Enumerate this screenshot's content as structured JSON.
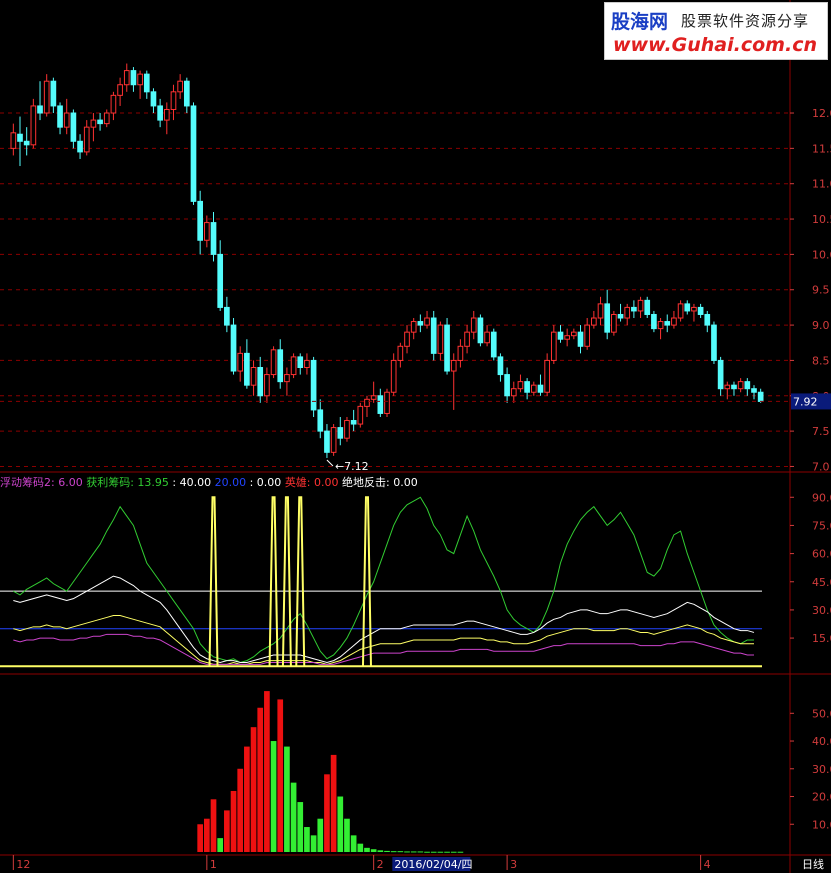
{
  "logo": {
    "brand": "股海网",
    "slogan": "股票软件资源分享",
    "url": "www.Guhai.com.cn"
  },
  "colors": {
    "up": "#ff3232",
    "down": "#54fcfc",
    "grid": "#8b0000",
    "axis": "#d23c3c",
    "green": "#32cd32",
    "white": "#ffffff",
    "yellow": "#ffff66",
    "magenta": "#cc44cc",
    "blue": "#2244ff"
  },
  "price_panel": {
    "y_ticks": [
      "12.0",
      "11.5",
      "11.0",
      "10.5",
      "10.0",
      "9.5",
      "9.0",
      "8.5",
      "8.0",
      "7.5",
      "7.0"
    ],
    "y_values": [
      12.0,
      11.5,
      11.0,
      10.5,
      10.0,
      9.5,
      9.0,
      8.5,
      8.0,
      7.5,
      7.0
    ],
    "current_price": "7.92",
    "low_marker": "7.12"
  },
  "indicator_panel": {
    "legend": [
      {
        "label": "浮动筹码2: ",
        "value": "6.00",
        "color": "#cc44cc"
      },
      {
        "label": "获利筹码: ",
        "value": "13.95",
        "color": "#32cd32"
      },
      {
        "label": " : ",
        "value": "40.00",
        "color": "#ffffff"
      },
      {
        "label": "20.00",
        "value": "",
        "color": "#2244ff"
      },
      {
        "label": " : ",
        "value": "0.00",
        "color": "#ffffff"
      },
      {
        "label": "英雄: ",
        "value": "0.00",
        "color": "#ff3232"
      },
      {
        "label": "绝地反击: ",
        "value": "0.00",
        "color": "#ffffff"
      }
    ],
    "y_ticks": [
      "90.0",
      "75.0",
      "60.0",
      "45.0",
      "30.0",
      "15.0"
    ],
    "y_values": [
      90,
      75,
      60,
      45,
      30,
      15
    ],
    "reference_lines": [
      40,
      20,
      0
    ]
  },
  "histogram_panel": {
    "y_ticks": [
      "50.0",
      "40.0",
      "30.0",
      "20.0",
      "10.0"
    ],
    "y_values": [
      50,
      40,
      30,
      20,
      10
    ]
  },
  "time_axis": {
    "labels": [
      {
        "text": "12",
        "index": 0
      },
      {
        "text": "1",
        "index": 29
      },
      {
        "text": "2",
        "index": 54
      },
      {
        "text": "3",
        "index": 74
      },
      {
        "text": "4",
        "index": 103
      }
    ],
    "cursor_date": "2016/02/04/四",
    "cursor_index": 58,
    "period": "日线"
  },
  "chart_data": {
    "type": "candlestick",
    "ohlc": [
      [
        11.5,
        11.85,
        11.4,
        11.72
      ],
      [
        11.7,
        11.95,
        11.25,
        11.6
      ],
      [
        11.6,
        11.8,
        11.4,
        11.55
      ],
      [
        11.55,
        12.2,
        11.5,
        12.1
      ],
      [
        12.1,
        12.45,
        11.9,
        12.0
      ],
      [
        12.0,
        12.55,
        11.95,
        12.45
      ],
      [
        12.45,
        12.5,
        12.0,
        12.1
      ],
      [
        12.1,
        12.15,
        11.7,
        11.8
      ],
      [
        11.8,
        12.2,
        11.7,
        12.0
      ],
      [
        12.0,
        12.05,
        11.5,
        11.6
      ],
      [
        11.6,
        11.7,
        11.35,
        11.45
      ],
      [
        11.45,
        11.9,
        11.4,
        11.8
      ],
      [
        11.8,
        12.0,
        11.6,
        11.9
      ],
      [
        11.9,
        12.0,
        11.75,
        11.85
      ],
      [
        11.85,
        12.05,
        11.8,
        12.0
      ],
      [
        12.0,
        12.3,
        11.9,
        12.25
      ],
      [
        12.25,
        12.5,
        12.1,
        12.4
      ],
      [
        12.4,
        12.7,
        12.3,
        12.6
      ],
      [
        12.6,
        12.65,
        12.3,
        12.4
      ],
      [
        12.4,
        12.6,
        12.2,
        12.55
      ],
      [
        12.55,
        12.6,
        12.2,
        12.3
      ],
      [
        12.3,
        12.35,
        12.0,
        12.1
      ],
      [
        12.1,
        12.2,
        11.8,
        11.9
      ],
      [
        11.9,
        12.15,
        11.7,
        12.05
      ],
      [
        12.05,
        12.4,
        11.9,
        12.3
      ],
      [
        12.3,
        12.55,
        12.2,
        12.45
      ],
      [
        12.45,
        12.5,
        12.0,
        12.1
      ],
      [
        12.1,
        12.15,
        10.7,
        10.75
      ],
      [
        10.75,
        10.9,
        10.0,
        10.2
      ],
      [
        10.2,
        10.55,
        10.1,
        10.45
      ],
      [
        10.45,
        10.6,
        9.9,
        10.0
      ],
      [
        10.0,
        10.2,
        9.2,
        9.25
      ],
      [
        9.25,
        9.4,
        8.9,
        9.0
      ],
      [
        9.0,
        9.1,
        8.3,
        8.35
      ],
      [
        8.35,
        8.7,
        8.2,
        8.6
      ],
      [
        8.6,
        8.8,
        8.1,
        8.15
      ],
      [
        8.15,
        8.5,
        8.0,
        8.4
      ],
      [
        8.4,
        8.55,
        7.9,
        8.0
      ],
      [
        8.0,
        8.4,
        7.9,
        8.3
      ],
      [
        8.3,
        8.7,
        8.25,
        8.65
      ],
      [
        8.65,
        8.8,
        8.1,
        8.2
      ],
      [
        8.2,
        8.4,
        8.0,
        8.3
      ],
      [
        8.3,
        8.6,
        8.25,
        8.55
      ],
      [
        8.55,
        8.6,
        8.3,
        8.4
      ],
      [
        8.4,
        8.6,
        8.3,
        8.5
      ],
      [
        8.5,
        8.55,
        7.7,
        7.8
      ],
      [
        7.8,
        7.95,
        7.4,
        7.5
      ],
      [
        7.5,
        7.6,
        7.12,
        7.2
      ],
      [
        7.2,
        7.6,
        7.15,
        7.55
      ],
      [
        7.55,
        7.7,
        7.3,
        7.4
      ],
      [
        7.4,
        7.7,
        7.35,
        7.65
      ],
      [
        7.65,
        7.8,
        7.5,
        7.6
      ],
      [
        7.6,
        7.9,
        7.55,
        7.85
      ],
      [
        7.85,
        8.0,
        7.7,
        7.95
      ],
      [
        7.95,
        8.2,
        7.9,
        8.0
      ],
      [
        8.0,
        8.1,
        7.7,
        7.75
      ],
      [
        7.75,
        8.1,
        7.7,
        8.05
      ],
      [
        8.05,
        8.6,
        8.0,
        8.5
      ],
      [
        8.5,
        8.75,
        8.4,
        8.7
      ],
      [
        8.7,
        9.0,
        8.6,
        8.9
      ],
      [
        8.9,
        9.1,
        8.8,
        9.05
      ],
      [
        9.05,
        9.15,
        8.9,
        9.0
      ],
      [
        9.0,
        9.2,
        8.95,
        9.1
      ],
      [
        9.1,
        9.2,
        8.5,
        8.6
      ],
      [
        8.6,
        9.05,
        8.5,
        9.0
      ],
      [
        9.0,
        9.1,
        8.3,
        8.35
      ],
      [
        8.35,
        8.6,
        7.8,
        8.5
      ],
      [
        8.5,
        8.8,
        8.4,
        8.7
      ],
      [
        8.7,
        9.0,
        8.6,
        8.9
      ],
      [
        8.9,
        9.2,
        8.8,
        9.1
      ],
      [
        9.1,
        9.15,
        8.7,
        8.75
      ],
      [
        8.75,
        9.0,
        8.7,
        8.9
      ],
      [
        8.9,
        8.95,
        8.5,
        8.55
      ],
      [
        8.55,
        8.6,
        8.2,
        8.3
      ],
      [
        8.3,
        8.4,
        7.9,
        8.0
      ],
      [
        8.0,
        8.2,
        7.9,
        8.1
      ],
      [
        8.1,
        8.3,
        8.05,
        8.2
      ],
      [
        8.2,
        8.25,
        7.95,
        8.05
      ],
      [
        8.05,
        8.2,
        8.0,
        8.15
      ],
      [
        8.15,
        8.3,
        8.0,
        8.05
      ],
      [
        8.05,
        8.6,
        8.0,
        8.5
      ],
      [
        8.5,
        9.0,
        8.45,
        8.9
      ],
      [
        8.9,
        9.0,
        8.75,
        8.8
      ],
      [
        8.8,
        8.95,
        8.7,
        8.85
      ],
      [
        8.85,
        8.95,
        8.8,
        8.9
      ],
      [
        8.9,
        9.0,
        8.6,
        8.7
      ],
      [
        8.7,
        9.1,
        8.65,
        9.0
      ],
      [
        9.0,
        9.2,
        8.95,
        9.1
      ],
      [
        9.1,
        9.4,
        9.0,
        9.3
      ],
      [
        9.3,
        9.5,
        8.8,
        8.9
      ],
      [
        8.9,
        9.2,
        8.85,
        9.15
      ],
      [
        9.15,
        9.3,
        9.05,
        9.1
      ],
      [
        9.1,
        9.3,
        9.0,
        9.25
      ],
      [
        9.25,
        9.35,
        9.1,
        9.2
      ],
      [
        9.2,
        9.4,
        9.1,
        9.35
      ],
      [
        9.35,
        9.4,
        9.1,
        9.15
      ],
      [
        9.15,
        9.2,
        8.9,
        8.95
      ],
      [
        8.95,
        9.1,
        8.8,
        9.05
      ],
      [
        9.05,
        9.15,
        8.9,
        9.0
      ],
      [
        9.0,
        9.2,
        8.95,
        9.1
      ],
      [
        9.1,
        9.35,
        9.05,
        9.3
      ],
      [
        9.3,
        9.35,
        9.15,
        9.2
      ],
      [
        9.2,
        9.3,
        9.05,
        9.25
      ],
      [
        9.25,
        9.3,
        9.1,
        9.15
      ],
      [
        9.15,
        9.2,
        8.9,
        9.0
      ],
      [
        9.0,
        9.05,
        8.45,
        8.5
      ],
      [
        8.5,
        8.55,
        8.0,
        8.1
      ],
      [
        8.1,
        8.2,
        7.95,
        8.15
      ],
      [
        8.15,
        8.2,
        8.0,
        8.1
      ],
      [
        8.1,
        8.25,
        8.05,
        8.2
      ],
      [
        8.2,
        8.25,
        8.0,
        8.1
      ],
      [
        8.1,
        8.15,
        7.95,
        8.05
      ],
      [
        8.05,
        8.1,
        7.9,
        7.92
      ]
    ],
    "indicator_series": {
      "green": [
        40,
        38,
        41,
        43,
        45,
        47,
        44,
        42,
        40,
        45,
        50,
        55,
        60,
        65,
        72,
        78,
        85,
        80,
        75,
        65,
        55,
        50,
        45,
        40,
        35,
        30,
        25,
        20,
        12,
        8,
        5,
        4,
        3,
        4,
        2,
        3,
        5,
        8,
        10,
        12,
        15,
        20,
        25,
        28,
        22,
        15,
        8,
        4,
        6,
        10,
        15,
        22,
        30,
        38,
        45,
        55,
        65,
        75,
        82,
        86,
        88,
        90,
        84,
        75,
        70,
        62,
        60,
        70,
        80,
        72,
        62,
        55,
        48,
        40,
        30,
        25,
        22,
        20,
        18,
        22,
        30,
        40,
        55,
        65,
        72,
        78,
        82,
        85,
        80,
        75,
        78,
        82,
        76,
        70,
        60,
        50,
        48,
        52,
        62,
        70,
        72,
        60,
        50,
        40,
        30,
        22,
        18,
        15,
        13,
        12,
        14,
        13.95
      ],
      "white": [
        35,
        34,
        35,
        36,
        37,
        38,
        37,
        36,
        35,
        36,
        38,
        40,
        42,
        44,
        46,
        48,
        47,
        45,
        43,
        40,
        38,
        36,
        34,
        30,
        25,
        20,
        15,
        10,
        6,
        4,
        3,
        2,
        3,
        3,
        2,
        2,
        3,
        4,
        5,
        6,
        6,
        6,
        6,
        6,
        5,
        4,
        3,
        2,
        3,
        5,
        8,
        11,
        14,
        16,
        18,
        20,
        20,
        20,
        20,
        21,
        22,
        22,
        22,
        22,
        22,
        22,
        22,
        23,
        24,
        24,
        23,
        22,
        21,
        20,
        19,
        18,
        17,
        17,
        18,
        20,
        23,
        25,
        26,
        28,
        29,
        30,
        30,
        29,
        28,
        28,
        29,
        30,
        30,
        29,
        28,
        27,
        26,
        27,
        28,
        30,
        32,
        34,
        33,
        31,
        29,
        26,
        24,
        22,
        20,
        19,
        19,
        18
      ],
      "yellow": [
        20,
        19,
        20,
        21,
        21,
        22,
        21,
        21,
        20,
        21,
        22,
        23,
        24,
        25,
        26,
        27,
        27,
        26,
        25,
        24,
        23,
        22,
        21,
        18,
        15,
        12,
        9,
        6,
        3,
        2,
        1,
        1,
        1,
        2,
        1,
        1,
        2,
        2,
        3,
        3,
        3,
        3,
        3,
        3,
        3,
        2,
        2,
        1,
        2,
        3,
        5,
        7,
        9,
        10,
        11,
        12,
        12,
        12,
        12,
        13,
        14,
        14,
        14,
        14,
        14,
        14,
        14,
        15,
        15,
        15,
        15,
        14,
        14,
        13,
        13,
        12,
        12,
        12,
        13,
        14,
        16,
        17,
        18,
        19,
        20,
        20,
        20,
        19,
        19,
        19,
        19,
        20,
        20,
        19,
        18,
        18,
        17,
        18,
        19,
        20,
        21,
        22,
        21,
        20,
        18,
        17,
        15,
        14,
        13,
        12,
        12,
        12
      ],
      "magenta": [
        14,
        13,
        14,
        14,
        15,
        15,
        15,
        14,
        14,
        14,
        15,
        15,
        16,
        16,
        17,
        17,
        17,
        17,
        16,
        16,
        15,
        15,
        14,
        12,
        10,
        8,
        6,
        4,
        2,
        1,
        1,
        1,
        1,
        1,
        1,
        1,
        1,
        1,
        2,
        2,
        2,
        2,
        2,
        2,
        2,
        2,
        1,
        1,
        1,
        2,
        3,
        4,
        5,
        6,
        7,
        7,
        7,
        7,
        7,
        8,
        8,
        8,
        8,
        8,
        8,
        8,
        8,
        9,
        9,
        9,
        9,
        9,
        8,
        8,
        8,
        8,
        8,
        8,
        8,
        9,
        10,
        11,
        11,
        12,
        12,
        12,
        12,
        12,
        12,
        12,
        12,
        12,
        12,
        12,
        11,
        11,
        11,
        11,
        12,
        12,
        13,
        13,
        13,
        12,
        11,
        10,
        9,
        8,
        7,
        7,
        6,
        6
      ]
    },
    "yellow_spikes": [
      30,
      39,
      41,
      43,
      53
    ],
    "histogram": [
      {
        "i": 28,
        "v": 10,
        "c": "red"
      },
      {
        "i": 29,
        "v": 12,
        "c": "red"
      },
      {
        "i": 30,
        "v": 19,
        "c": "red"
      },
      {
        "i": 31,
        "v": 5,
        "c": "green"
      },
      {
        "i": 32,
        "v": 15,
        "c": "red"
      },
      {
        "i": 33,
        "v": 22,
        "c": "red"
      },
      {
        "i": 34,
        "v": 30,
        "c": "red"
      },
      {
        "i": 35,
        "v": 38,
        "c": "red"
      },
      {
        "i": 36,
        "v": 45,
        "c": "red"
      },
      {
        "i": 37,
        "v": 52,
        "c": "red"
      },
      {
        "i": 38,
        "v": 58,
        "c": "red"
      },
      {
        "i": 39,
        "v": 40,
        "c": "green"
      },
      {
        "i": 40,
        "v": 55,
        "c": "red"
      },
      {
        "i": 41,
        "v": 38,
        "c": "green"
      },
      {
        "i": 42,
        "v": 25,
        "c": "green"
      },
      {
        "i": 43,
        "v": 18,
        "c": "green"
      },
      {
        "i": 44,
        "v": 9,
        "c": "green"
      },
      {
        "i": 45,
        "v": 6,
        "c": "green"
      },
      {
        "i": 46,
        "v": 12,
        "c": "green"
      },
      {
        "i": 47,
        "v": 28,
        "c": "red"
      },
      {
        "i": 48,
        "v": 35,
        "c": "red"
      },
      {
        "i": 49,
        "v": 20,
        "c": "green"
      },
      {
        "i": 50,
        "v": 12,
        "c": "green"
      },
      {
        "i": 51,
        "v": 6,
        "c": "green"
      },
      {
        "i": 52,
        "v": 3,
        "c": "green"
      },
      {
        "i": 53,
        "v": 1.5,
        "c": "green"
      },
      {
        "i": 54,
        "v": 1,
        "c": "green"
      },
      {
        "i": 55,
        "v": 0.6,
        "c": "green"
      },
      {
        "i": 56,
        "v": 0.4,
        "c": "green"
      },
      {
        "i": 57,
        "v": 0.3,
        "c": "green"
      },
      {
        "i": 58,
        "v": 0.3,
        "c": "green"
      },
      {
        "i": 59,
        "v": 0.2,
        "c": "green"
      },
      {
        "i": 60,
        "v": 0.2,
        "c": "green"
      },
      {
        "i": 61,
        "v": 0.2,
        "c": "green"
      },
      {
        "i": 62,
        "v": 0.1,
        "c": "green"
      },
      {
        "i": 63,
        "v": 0.1,
        "c": "green"
      },
      {
        "i": 64,
        "v": 0.1,
        "c": "green"
      },
      {
        "i": 65,
        "v": 0.1,
        "c": "green"
      },
      {
        "i": 66,
        "v": 0.1,
        "c": "green"
      },
      {
        "i": 67,
        "v": 0.1,
        "c": "green"
      }
    ],
    "ylim_price": [
      6.95,
      12.75
    ],
    "ylim_indicator": [
      -2,
      96
    ],
    "ylim_histogram": [
      0,
      62
    ]
  }
}
